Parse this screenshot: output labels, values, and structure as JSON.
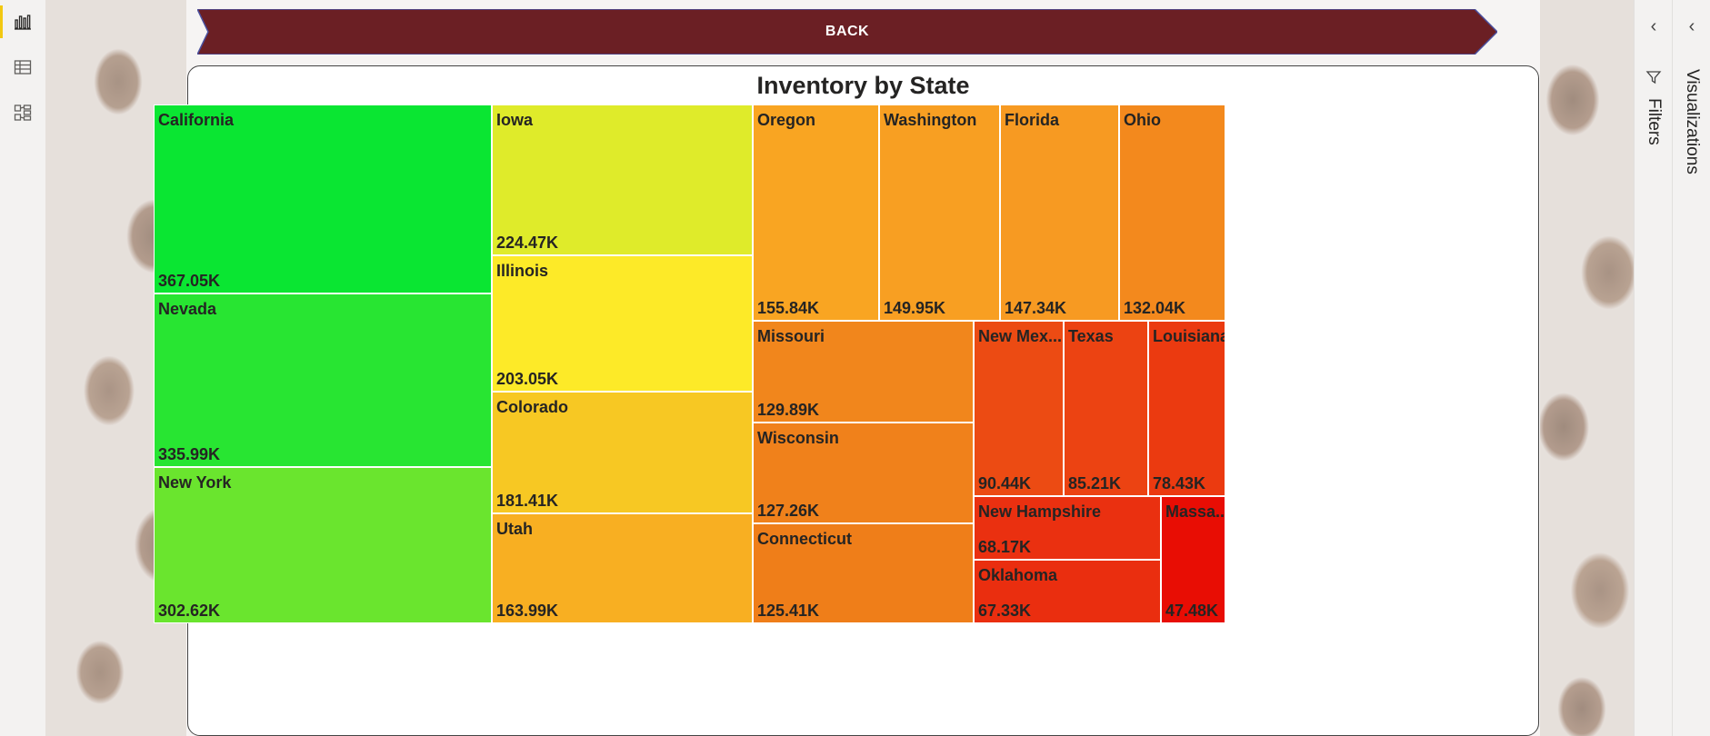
{
  "left_rail": {
    "items": [
      {
        "icon": "report-view-icon",
        "active": true
      },
      {
        "icon": "table-view-icon",
        "active": false
      },
      {
        "icon": "model-view-icon",
        "active": false
      }
    ]
  },
  "back_button": {
    "label": "BACK",
    "color": "#6b1f24"
  },
  "visual": {
    "title": "Inventory by State"
  },
  "chart_data": {
    "type": "treemap",
    "title": "Inventory by State",
    "color_scale": {
      "high": "#0ae632",
      "mid": "#fdea28",
      "low": "#e80d04"
    },
    "items": [
      {
        "name": "California",
        "value_label": "367.05K",
        "value": 367.05,
        "color": "#0ae632"
      },
      {
        "name": "Nevada",
        "value_label": "335.99K",
        "value": 335.99,
        "color": "#28e532"
      },
      {
        "name": "New York",
        "value_label": "302.62K",
        "value": 302.62,
        "color": "#6ae52e"
      },
      {
        "name": "Iowa",
        "value_label": "224.47K",
        "value": 224.47,
        "color": "#dfeb2a"
      },
      {
        "name": "Illinois",
        "value_label": "203.05K",
        "value": 203.05,
        "color": "#fdea28"
      },
      {
        "name": "Colorado",
        "value_label": "181.41K",
        "value": 181.41,
        "color": "#f7c823"
      },
      {
        "name": "Utah",
        "value_label": "163.99K",
        "value": 163.99,
        "color": "#f8af22"
      },
      {
        "name": "Oregon",
        "value_label": "155.84K",
        "value": 155.84,
        "color": "#f9a522"
      },
      {
        "name": "Washington",
        "value_label": "149.95K",
        "value": 149.95,
        "color": "#f89f22"
      },
      {
        "name": "Florida",
        "value_label": "147.34K",
        "value": 147.34,
        "color": "#f79a22"
      },
      {
        "name": "Ohio",
        "value_label": "132.04K",
        "value": 132.04,
        "color": "#f3891d"
      },
      {
        "name": "Missouri",
        "value_label": "129.89K",
        "value": 129.89,
        "color": "#f1861c"
      },
      {
        "name": "Wisconsin",
        "value_label": "127.26K",
        "value": 127.26,
        "color": "#f0811b"
      },
      {
        "name": "Connecticut",
        "value_label": "125.41K",
        "value": 125.41,
        "color": "#ef7e19"
      },
      {
        "name": "New Mex...",
        "value_label": "90.44K",
        "value": 90.44,
        "color": "#ec4b13"
      },
      {
        "name": "Texas",
        "value_label": "85.21K",
        "value": 85.21,
        "color": "#ec4312"
      },
      {
        "name": "Louisiana",
        "value_label": "78.43K",
        "value": 78.43,
        "color": "#eb3a10"
      },
      {
        "name": "New Hampshire",
        "value_label": "68.17K",
        "value": 68.17,
        "color": "#ea3010"
      },
      {
        "name": "Oklahoma",
        "value_label": "67.33K",
        "value": 67.33,
        "color": "#ea2e0f"
      },
      {
        "name": "Massa...",
        "value_label": "47.48K",
        "value": 47.48,
        "color": "#e80d04"
      }
    ]
  },
  "panes": {
    "filters": {
      "label": "Filters"
    },
    "visualizations": {
      "label": "Visualizations"
    }
  }
}
